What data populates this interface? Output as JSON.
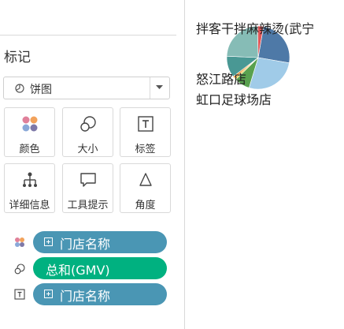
{
  "marks_panel": {
    "title": "标记",
    "mark_type": {
      "label": "饼图",
      "icon": "pie-mark-icon"
    },
    "cards": [
      {
        "id": "color",
        "label": "颜色",
        "icon": "color-dots-icon"
      },
      {
        "id": "size",
        "label": "大小",
        "icon": "size-circles-icon"
      },
      {
        "id": "label",
        "label": "标签",
        "icon": "text-label-icon"
      },
      {
        "id": "detail",
        "label": "详细信息",
        "icon": "detail-tree-icon"
      },
      {
        "id": "tooltip",
        "label": "工具提示",
        "icon": "tooltip-bubble-icon"
      },
      {
        "id": "angle",
        "label": "角度",
        "icon": "angle-icon"
      }
    ],
    "shelf": [
      {
        "icon": "color-dots-icon",
        "text": "门店名称",
        "color": "#4a96b4",
        "has_plus": true
      },
      {
        "icon": "size-circles-icon",
        "text": "总和(GMV)",
        "color": "#00b180",
        "has_plus": false
      },
      {
        "icon": "text-label-icon",
        "text": "门店名称",
        "color": "#4a96b4",
        "has_plus": true
      }
    ]
  },
  "chart_data": {
    "type": "pie",
    "labels": [
      "拌客干拌麻辣烫(武宁",
      "怒江路店",
      "虹口足球场店"
    ],
    "colors": [
      "#4e79a7",
      "#a0cbe8",
      "#59a14f",
      "#edc948",
      "#f28e2b",
      "#499894",
      "#86bcb6",
      "#e15759"
    ],
    "values": [
      25,
      27,
      8,
      1,
      1,
      11,
      24,
      3
    ]
  }
}
